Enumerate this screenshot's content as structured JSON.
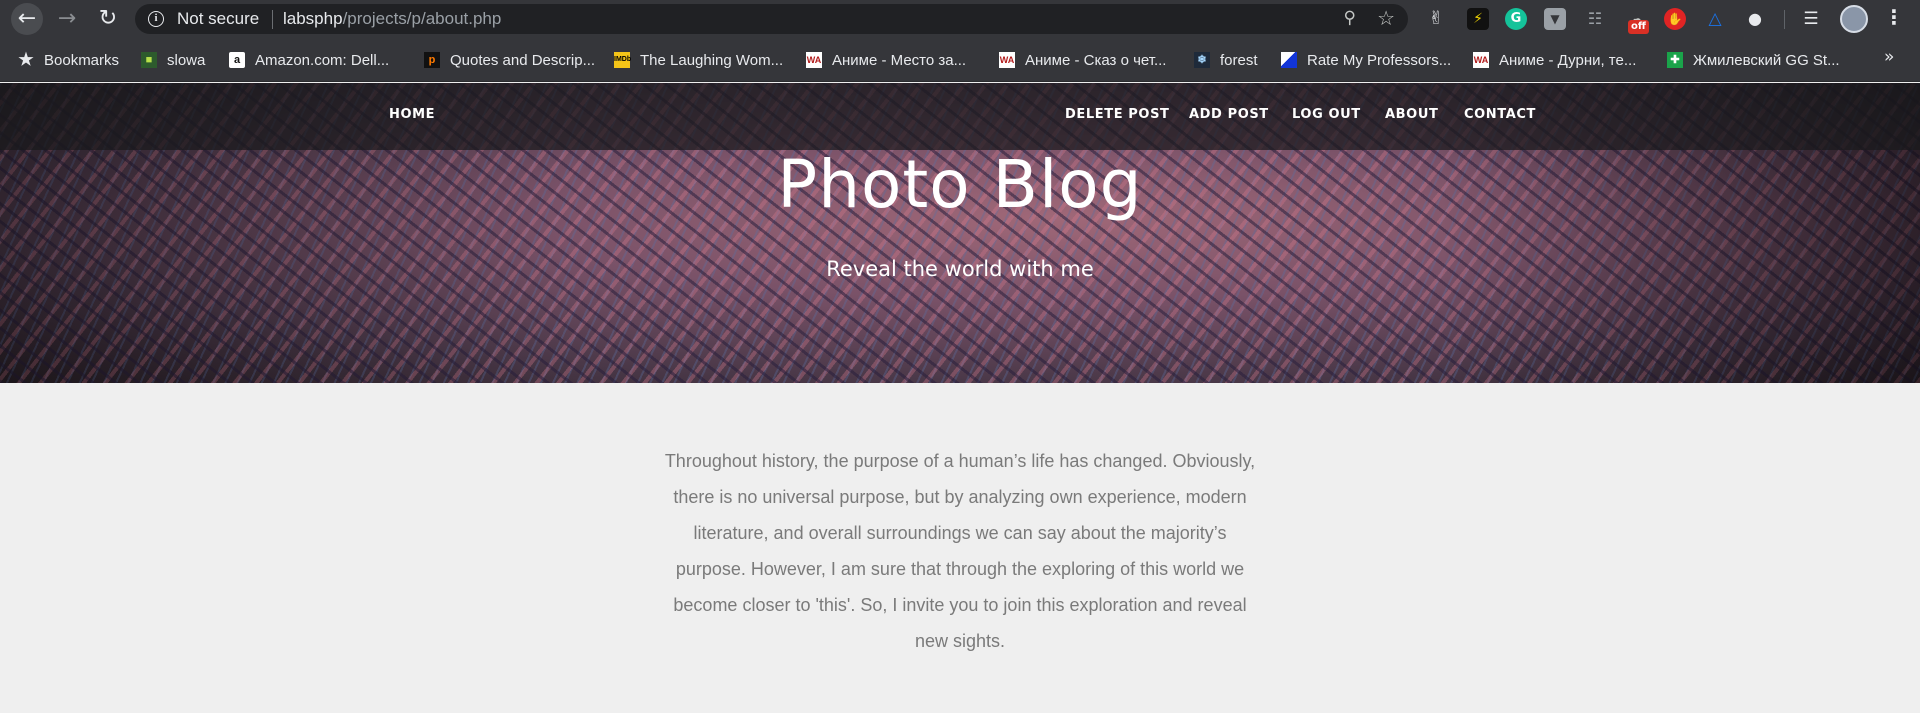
{
  "browser": {
    "security_label": "Not secure",
    "url_host": "labsphp",
    "url_path": "/projects/p/about.php",
    "nav_icons": {
      "back": "back-arrow-icon",
      "forward": "forward-arrow-icon",
      "reload": "reload-icon"
    },
    "extensions_badge": "off",
    "bookmarks": [
      {
        "label": "Bookmarks",
        "icon": "star-icon"
      },
      {
        "label": "slowa",
        "icon": "slowa-favicon"
      },
      {
        "label": "Amazon.com: Dell...",
        "icon": "amazon-favicon"
      },
      {
        "label": "Quotes and Descrip...",
        "icon": "quotes-favicon"
      },
      {
        "label": "The Laughing Wom...",
        "icon": "imdb-favicon"
      },
      {
        "label": "Аниме - Место за...",
        "icon": "wa-favicon"
      },
      {
        "label": "Аниме - Сказ о чет...",
        "icon": "wa-favicon"
      },
      {
        "label": "forest",
        "icon": "forest-favicon"
      },
      {
        "label": "Rate My Professors...",
        "icon": "rmp-favicon"
      },
      {
        "label": "Аниме - Дурни, те...",
        "icon": "wa-favicon"
      },
      {
        "label": "Жмилевский GG St...",
        "icon": "green-cross-favicon"
      }
    ],
    "bookmarks_more": "»"
  },
  "site": {
    "nav": {
      "home": "HOME",
      "delete_post": "DELETE POST",
      "add_post": "ADD POST",
      "log_out": "LOG OUT",
      "about": "ABOUT",
      "contact": "CONTACT"
    },
    "title": "Photo Blog",
    "subtitle": "Reveal the world with me",
    "about_text": "Throughout history, the purpose of a human’s life has changed. Obviously, there is no universal purpose, but by analyzing own experience, modern literature, and overall surroundings we can say about the majority’s purpose. However, I am sure that through the exploring of this world we become closer to 'this'. So, I invite you to join this exploration and reveal new sights."
  },
  "colors": {
    "chrome_bg": "#35363a",
    "omnibox_bg": "#202124",
    "page_bg": "#efefef",
    "body_text": "#7a7a7a"
  }
}
